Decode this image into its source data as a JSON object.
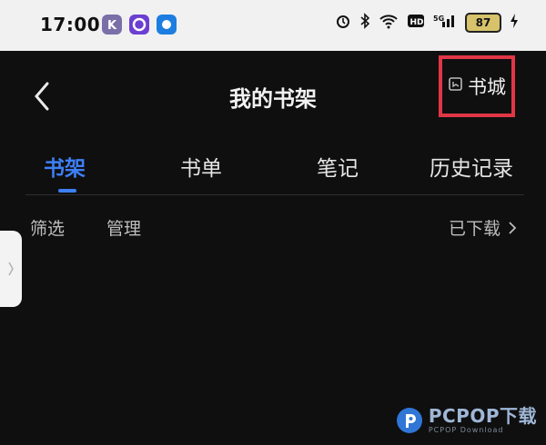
{
  "status_bar": {
    "time": "17:00",
    "battery": "87",
    "icons": [
      "kuaishou-icon",
      "app-circle-icon",
      "app-blue-icon",
      "alarm-icon",
      "bluetooth-icon",
      "wifi-icon",
      "hd-icon",
      "signal-icon",
      "charging-icon"
    ]
  },
  "nav": {
    "title": "我的书架",
    "store_label": "书城",
    "highlight_color": "#e13645"
  },
  "tabs": [
    {
      "label": "书架",
      "active": true
    },
    {
      "label": "书单",
      "active": false
    },
    {
      "label": "笔记",
      "active": false
    },
    {
      "label": "历史记录",
      "active": false
    }
  ],
  "toolbar": {
    "filter_label": "筛选",
    "manage_label": "管理",
    "downloaded_label": "已下载"
  },
  "watermark": {
    "main": "PCPOP下载",
    "sub": "PCPOP Download"
  },
  "colors": {
    "accent": "#3d7ff5",
    "background": "#0f0f10"
  }
}
